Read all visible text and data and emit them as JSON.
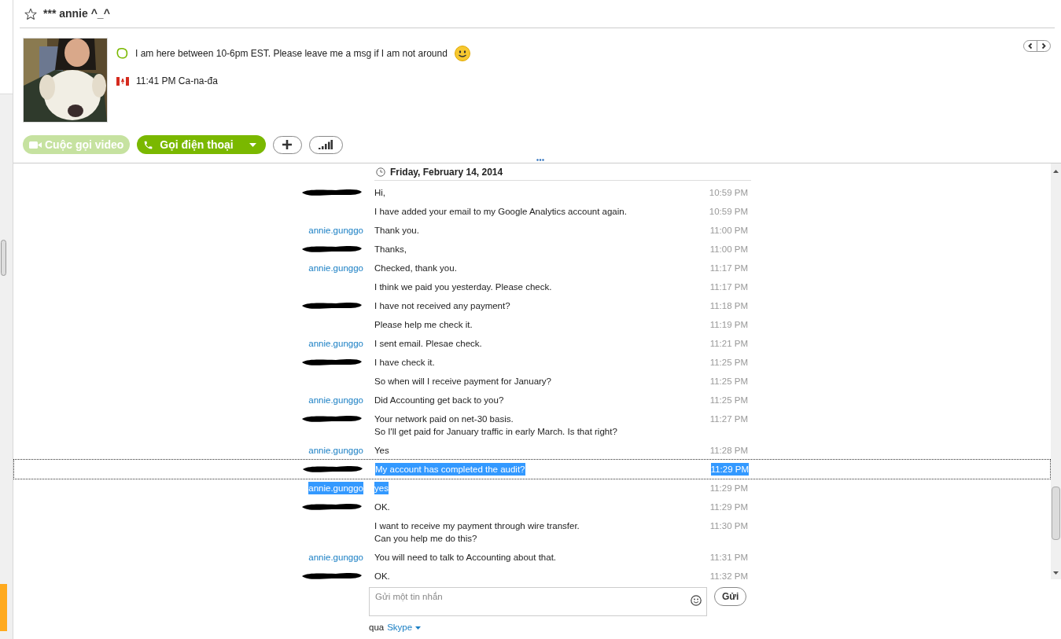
{
  "contact": {
    "name": "*** annie ^_^",
    "favorite": false,
    "mood": "I am here between 10-6pm EST. Please leave me a msg if I am not around",
    "local_time": "11:41 PM Ca-na-đa"
  },
  "actions": [
    {
      "kind": "video",
      "label": "Cuộc gọi video",
      "disabled": true
    },
    {
      "kind": "call",
      "label": "Gọi điện thoại",
      "disabled": false
    },
    {
      "kind": "add"
    },
    {
      "kind": "signal"
    }
  ],
  "date_header": "Friday, February 14, 2014",
  "messages": [
    {
      "kind": "redacted",
      "lines": [
        "Hi,"
      ],
      "time": "10:59 PM",
      "selected": false,
      "focused": false
    },
    {
      "kind": "none",
      "lines": [
        "I have added your email to my Google Analytics account again."
      ],
      "time": "10:59 PM",
      "selected": false,
      "focused": false
    },
    {
      "kind": "named",
      "sender": "annie.gunggo",
      "lines": [
        "Thank you."
      ],
      "time": "11:00 PM",
      "selected": false,
      "focused": false
    },
    {
      "kind": "redacted",
      "lines": [
        "Thanks,"
      ],
      "time": "11:00 PM",
      "selected": false,
      "focused": false
    },
    {
      "kind": "named",
      "sender": "annie.gunggo",
      "lines": [
        "Checked, thank you."
      ],
      "time": "11:17 PM",
      "selected": false,
      "focused": false
    },
    {
      "kind": "none",
      "lines": [
        "I think we paid you yesterday. Please check."
      ],
      "time": "11:17 PM",
      "selected": false,
      "focused": false
    },
    {
      "kind": "redacted",
      "lines": [
        "I have not received any payment?"
      ],
      "time": "11:18 PM",
      "selected": false,
      "focused": false
    },
    {
      "kind": "none",
      "lines": [
        "Please help me check it."
      ],
      "time": "11:19 PM",
      "selected": false,
      "focused": false
    },
    {
      "kind": "named",
      "sender": "annie.gunggo",
      "lines": [
        "I sent email. Plesae check."
      ],
      "time": "11:21 PM",
      "selected": false,
      "focused": false
    },
    {
      "kind": "redacted",
      "lines": [
        "I have check it."
      ],
      "time": "11:25 PM",
      "selected": false,
      "focused": false
    },
    {
      "kind": "none",
      "lines": [
        "So when will I receive payment for January?"
      ],
      "time": "11:25 PM",
      "selected": false,
      "focused": false
    },
    {
      "kind": "named",
      "sender": "annie.gunggo",
      "lines": [
        "Did Accounting get back to you?"
      ],
      "time": "11:25 PM",
      "selected": false,
      "focused": false
    },
    {
      "kind": "redacted",
      "lines": [
        "Your network paid on net-30 basis.",
        "So I'll get paid for January traffic in early March. Is that right?"
      ],
      "time": "11:27 PM",
      "selected": false,
      "focused": false
    },
    {
      "kind": "named",
      "sender": "annie.gunggo",
      "lines": [
        "Yes"
      ],
      "time": "11:28 PM",
      "selected": false,
      "focused": false
    },
    {
      "kind": "redacted",
      "lines": [
        "My account has completed the audit?"
      ],
      "time": "11:29 PM",
      "selected": true,
      "focused": true
    },
    {
      "kind": "named",
      "sender": "annie.gunggo",
      "lines": [
        "yes"
      ],
      "time": "11:29 PM",
      "selected": true,
      "focused": false
    },
    {
      "kind": "redacted",
      "lines": [
        "OK."
      ],
      "time": "11:29 PM",
      "selected": false,
      "focused": false
    },
    {
      "kind": "none",
      "lines": [
        "I want to receive my payment through wire transfer.",
        "Can you help me do this?"
      ],
      "time": "11:30 PM",
      "selected": false,
      "focused": false
    },
    {
      "kind": "named",
      "sender": "annie.gunggo",
      "lines": [
        "You will need to talk to Accounting about that."
      ],
      "time": "11:31 PM",
      "selected": false,
      "focused": false
    },
    {
      "kind": "redacted",
      "lines": [
        "OK."
      ],
      "time": "11:32 PM",
      "selected": false,
      "focused": false
    }
  ],
  "composer": {
    "placeholder": "Gửi một tin nhắn",
    "send": "Gửi",
    "via_label": "qua",
    "via_service": "Skype"
  }
}
